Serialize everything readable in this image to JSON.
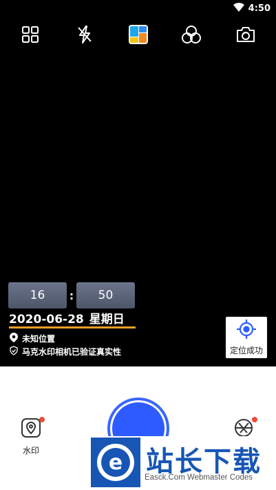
{
  "status_bar": {
    "time": "4:50"
  },
  "toolbar": {
    "icons": [
      "grid-icon",
      "flash-off-icon",
      "template-icon",
      "filter-icon",
      "switch-camera-icon"
    ]
  },
  "watermark": {
    "hour": "16",
    "colon": ":",
    "minute": "50",
    "date": "2020-06-28",
    "weekday": "星期日",
    "location": "未知位置",
    "verify_text": "马克水印相机已验证真实性",
    "accent_color": "#f0a02a"
  },
  "location_button": {
    "label": "定位成功"
  },
  "bottom": {
    "watermark_label": "水印",
    "shutter_color": "#2d5bff"
  },
  "banner": {
    "title": "站长下载",
    "subtitle": "Easck.Com Webmaster Codes"
  }
}
